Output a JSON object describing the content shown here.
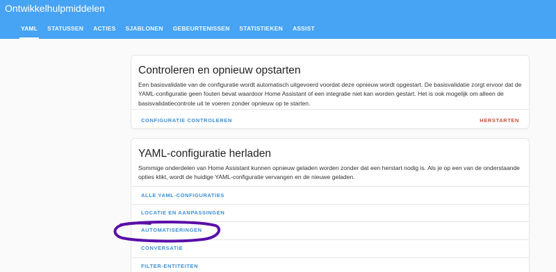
{
  "header": {
    "title": "Ontwikkelhulpmiddelen",
    "tabs": [
      {
        "label": "YAML"
      },
      {
        "label": "STATUSSEN"
      },
      {
        "label": "ACTIES"
      },
      {
        "label": "SJABLONEN"
      },
      {
        "label": "GEBEURTENISSEN"
      },
      {
        "label": "STATISTIEKEN"
      },
      {
        "label": "ASSIST"
      }
    ],
    "active_tab": "YAML"
  },
  "check_card": {
    "title": "Controleren en opnieuw opstarten",
    "description": "Een basisvalidatie van de configuratie wordt automatisch uitgevoerd voordat deze opnieuw wordt opgestart. De basisvalidatie zorgt ervoor dat de YAML-configuratie geen fouten bevat waardoor Home Assistant of een integratie niet kan worden gestart. Het is ook mogelijk om alleen de basisvalidatiecontrole uit te voeren zonder opnieuw op te starten.",
    "check_label": "CONFIGURATIE CONTROLEREN",
    "restart_label": "HERSTARTEN"
  },
  "reload_card": {
    "title": "YAML-configuratie herladen",
    "description": "Sommige onderdelen van Home Assistant kunnen opnieuw geladen worden zonder dat een herstart nodig is. Als je op een van de onderstaande opties klikt, wordt de huidige YAML-configuratie vervangen en de nieuwe geladen.",
    "items": [
      {
        "label": "ALLE YAML-CONFIGURATIES"
      },
      {
        "label": "LOCATIE EN AANPASSINGEN"
      },
      {
        "label": "AUTOMATISERINGEN"
      },
      {
        "label": "CONVERSATIE"
      },
      {
        "label": "FILTER-ENTITEITEN"
      }
    ]
  },
  "colors": {
    "header": "#47a3f3",
    "action": "#3a8fd8",
    "restart": "#c44d3a",
    "annotation": "#5a0fa8"
  }
}
